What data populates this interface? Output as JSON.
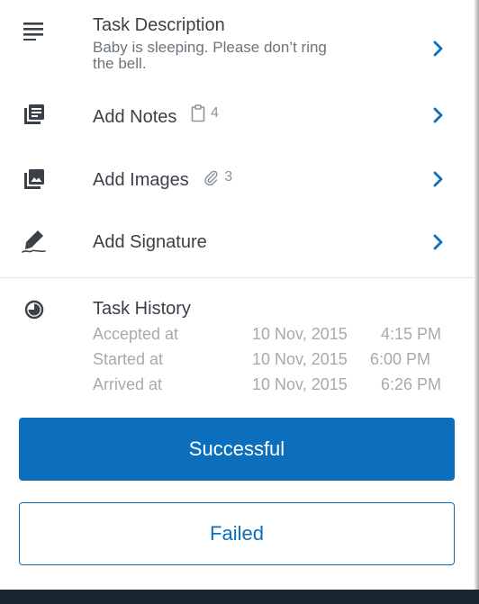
{
  "task_description": {
    "title": "Task Description",
    "text_line1": "Baby is sleeping. Please don’t ring",
    "text_line2": "the bell.",
    "icon": "lines-icon"
  },
  "add_notes": {
    "label": "Add Notes",
    "count": "4",
    "icon": "notes-icon",
    "count_icon": "clipboard-icon"
  },
  "add_images": {
    "label": "Add Images",
    "count": "3",
    "icon": "image-icon",
    "count_icon": "paperclip-icon"
  },
  "add_signature": {
    "label": "Add Signature",
    "icon": "pen-icon"
  },
  "task_history": {
    "title": "Task History",
    "icon": "history-icon",
    "entries": [
      {
        "event": "Accepted at",
        "date": "10 Nov, 2015",
        "time": "4:15 PM"
      },
      {
        "event": "Started at",
        "date": "10 Nov, 2015",
        "time": "6:00 PM"
      },
      {
        "event": "Arrived at",
        "date": "10 Nov, 2015",
        "time": "6:26 PM"
      }
    ]
  },
  "actions": {
    "success_label": "Successful",
    "failed_label": "Failed"
  },
  "colors": {
    "accent": "#0b6fbd",
    "text": "#3a4148",
    "muted": "#a3aab0",
    "bar": "#1a2733"
  }
}
